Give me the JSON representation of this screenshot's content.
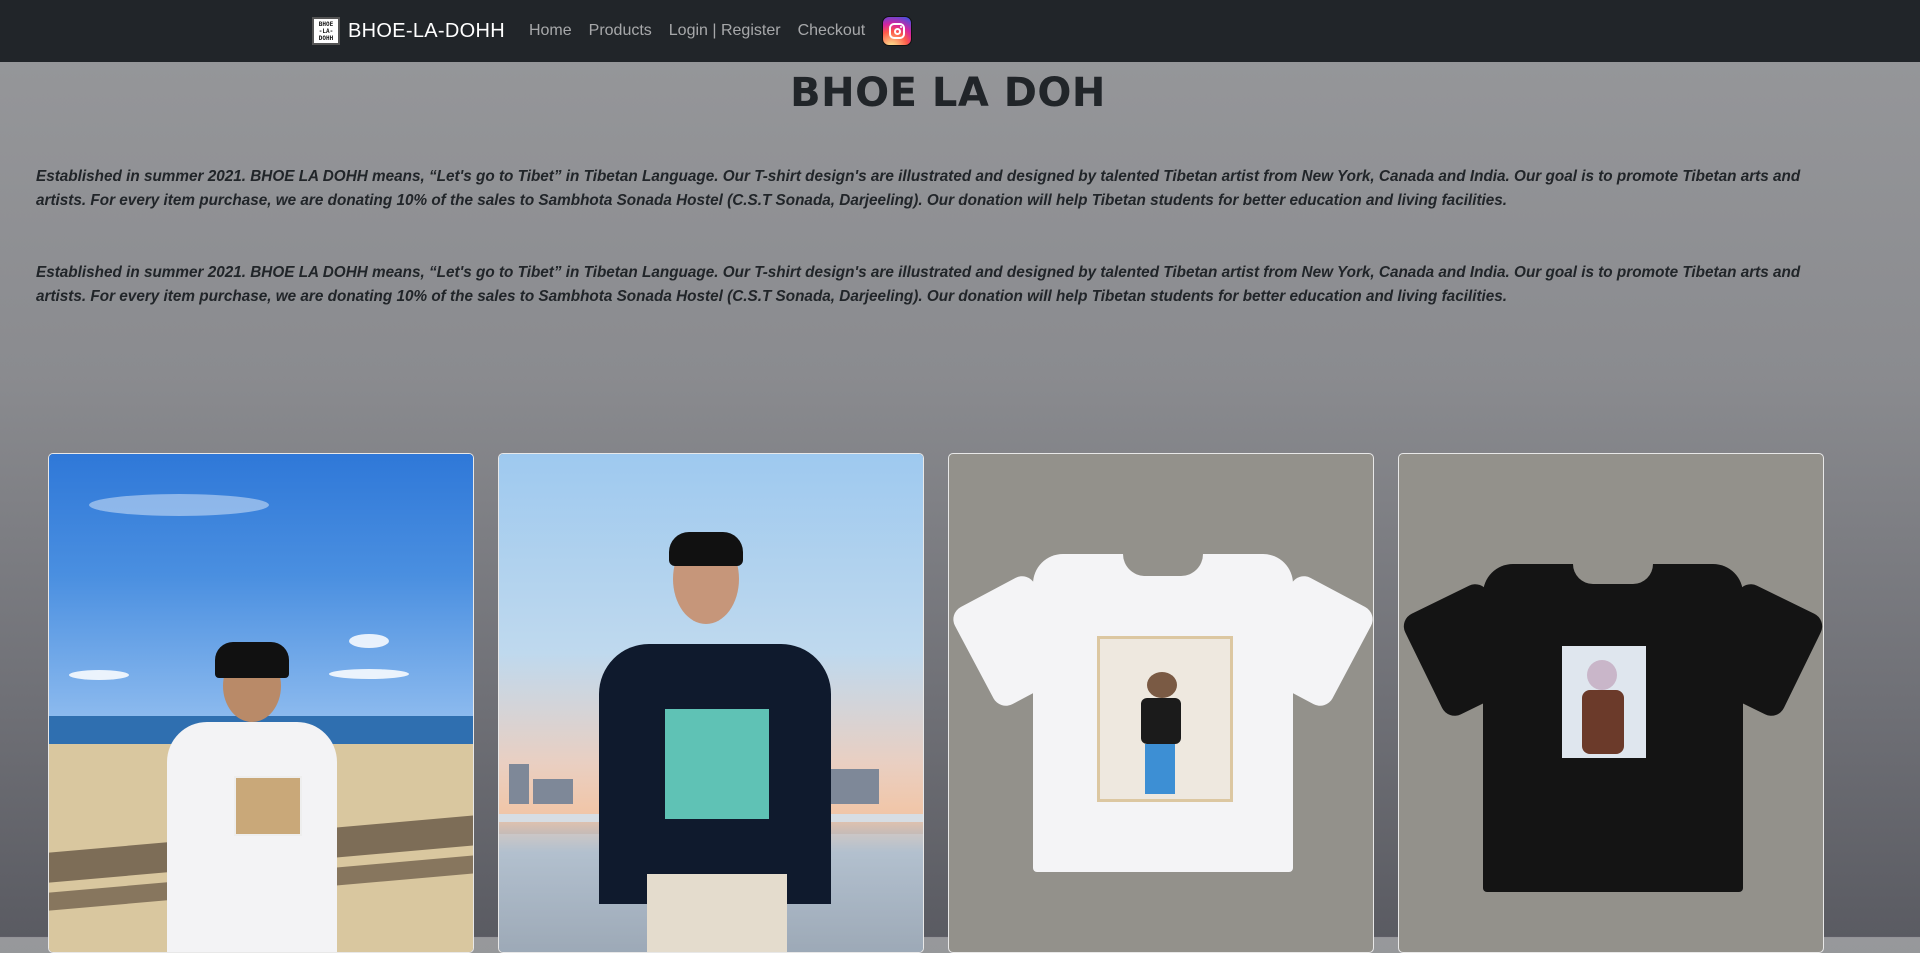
{
  "nav": {
    "brand": "BHOE-LA-DOHH",
    "logo_lines": [
      "BHOE",
      "-LA-",
      "DOHH"
    ],
    "links": [
      "Home",
      "Products",
      "Login | Register",
      "Checkout"
    ],
    "social_icon": "instagram-icon"
  },
  "main": {
    "title": "BHOE LA DOH",
    "about_paragraphs": [
      "Established in summer 2021. BHOE LA DOHH means, “Let's go to Tibet” in Tibetan Language. Our T-shirt design's are illustrated and designed by talented Tibetan artist from New York, Canada and India. Our goal is to promote Tibetan arts and artists. For every item purchase, we are donating 10% of the sales to Sambhota Sonada Hostel (C.S.T Sonada, Darjeeling). Our donation will help Tibetan students for better education and living facilities.",
      "Established in summer 2021. BHOE LA DOHH means, “Let's go to Tibet” in Tibetan Language. Our T-shirt design's are illustrated and designed by talented Tibetan artist from New York, Canada and India. Our goal is to promote Tibetan arts and artists. For every item purchase, we are donating 10% of the sales to Sambhota Sonada Hostel (C.S.T Sonada, Darjeeling). Our donation will help Tibetan students for better education and living facilities."
    ]
  },
  "colors": {
    "navbar": "#212529",
    "nav_link": "rgba(255,255,255,0.6)",
    "text": "#212529"
  }
}
